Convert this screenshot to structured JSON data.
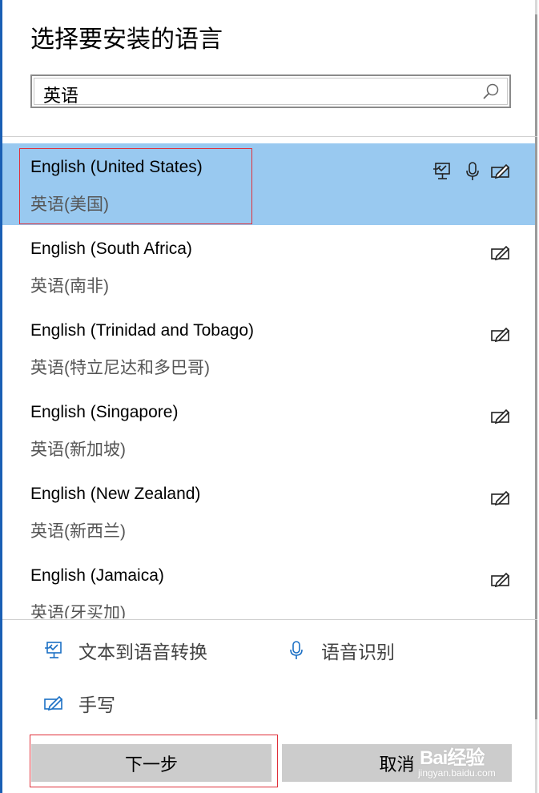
{
  "dialog": {
    "title": "选择要安装的语言"
  },
  "search": {
    "value": "英语",
    "icon": "search-icon"
  },
  "languages": [
    {
      "en": "English (United States)",
      "zh": "英语(美国)",
      "selected": true,
      "features": [
        "text-to-speech-icon",
        "microphone-icon",
        "handwriting-icon"
      ]
    },
    {
      "en": "English (South Africa)",
      "zh": "英语(南非)",
      "selected": false,
      "features": [
        "handwriting-icon"
      ]
    },
    {
      "en": "English (Trinidad and Tobago)",
      "zh": "英语(特立尼达和多巴哥)",
      "selected": false,
      "features": [
        "handwriting-icon"
      ]
    },
    {
      "en": "English (Singapore)",
      "zh": "英语(新加坡)",
      "selected": false,
      "features": [
        "handwriting-icon"
      ]
    },
    {
      "en": "English (New Zealand)",
      "zh": "英语(新西兰)",
      "selected": false,
      "features": [
        "handwriting-icon"
      ]
    },
    {
      "en": "English (Jamaica)",
      "zh": "英语(牙买加)",
      "selected": false,
      "features": [
        "handwriting-icon"
      ]
    }
  ],
  "legend": {
    "tts_label": "文本到语音转换",
    "speech_label": "语音识别",
    "handwriting_label": "手写"
  },
  "buttons": {
    "next_label": "下一步",
    "cancel_label": "取消"
  },
  "watermark": {
    "text": "Bai经验",
    "sub": "jingyan.baidu.com"
  },
  "colors": {
    "selected_bg": "#99c9f0",
    "accent": "#1a6fc4",
    "highlight_box": "#e0303a",
    "button_bg": "#cccccc"
  }
}
